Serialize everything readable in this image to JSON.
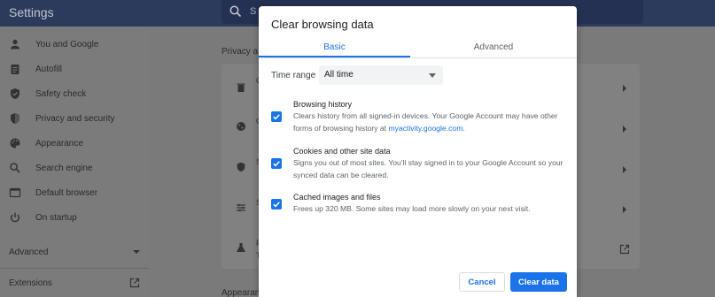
{
  "app": {
    "title": "Settings",
    "search_placeholder": "S"
  },
  "sidebar": {
    "items": [
      {
        "label": "You and Google",
        "icon": "person-icon"
      },
      {
        "label": "Autofill",
        "icon": "clipboard-icon"
      },
      {
        "label": "Safety check",
        "icon": "shield-check-icon"
      },
      {
        "label": "Privacy and security",
        "icon": "shield-icon"
      },
      {
        "label": "Appearance",
        "icon": "palette-icon"
      },
      {
        "label": "Search engine",
        "icon": "search-icon"
      },
      {
        "label": "Default browser",
        "icon": "browser-icon"
      },
      {
        "label": "On startup",
        "icon": "power-icon"
      }
    ],
    "advanced_label": "Advanced",
    "extensions_label": "Extensions"
  },
  "main": {
    "privacy_section_title": "Privacy a",
    "appearance_section_title": "Appearan",
    "card_row_letters": [
      "C",
      "C",
      "S",
      "S",
      "F",
      "T"
    ]
  },
  "dialog": {
    "title": "Clear browsing data",
    "tabs": {
      "basic": "Basic",
      "advanced": "Advanced"
    },
    "time_range": {
      "label": "Time range",
      "value": "All time"
    },
    "options": [
      {
        "title": "Browsing history",
        "desc_pre": "Clears history from all signed-in devices. Your Google Account may have other forms of browsing history at ",
        "desc_link": "myactivity.google.com",
        "desc_post": ".",
        "checked": true
      },
      {
        "title": "Cookies and other site data",
        "desc": "Signs you out of most sites. You'll stay signed in to your Google Account so your synced data can be cleared.",
        "checked": true
      },
      {
        "title": "Cached images and files",
        "desc": "Frees up 320 MB. Some sites may load more slowly on your next visit.",
        "checked": true
      }
    ],
    "buttons": {
      "cancel": "Cancel",
      "clear": "Clear data"
    }
  },
  "colors": {
    "accent": "#1a73e8",
    "topbar": "#2c3a5c",
    "overlay_bg": "#7a7a7a"
  }
}
